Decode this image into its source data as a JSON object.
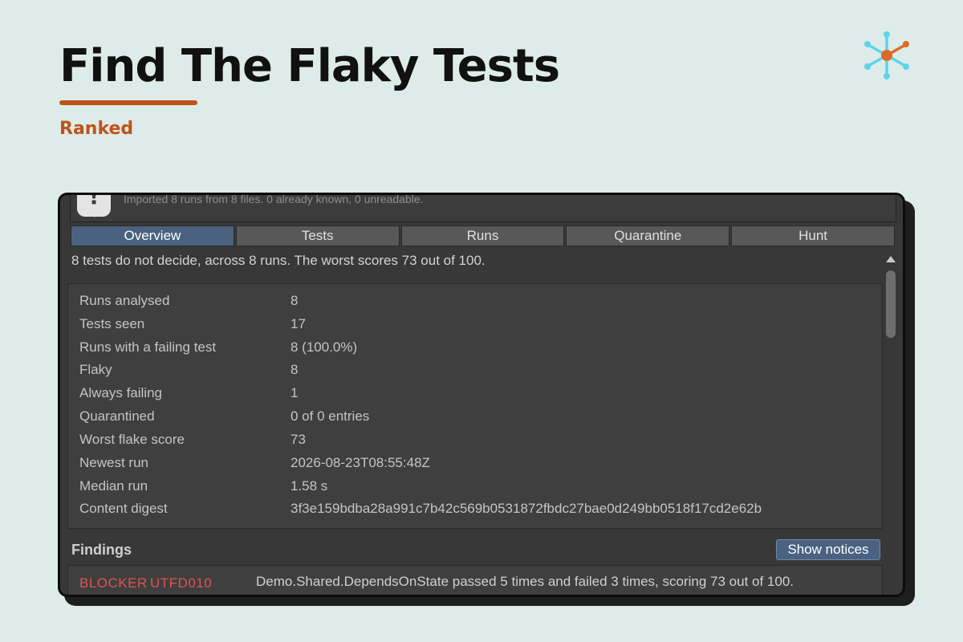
{
  "header": {
    "title": "Find The Flaky Tests",
    "subtitle": "Ranked",
    "accent_color": "#c0531a",
    "logo_colors": [
      "#5ed3ec",
      "#e0682a"
    ]
  },
  "notice": {
    "icon": "exclamation-speech-bubble-icon",
    "text": "Imported 8 runs from 8 files. 0 already known, 0 unreadable."
  },
  "tabs": [
    {
      "label": "Overview",
      "active": true
    },
    {
      "label": "Tests",
      "active": false
    },
    {
      "label": "Runs",
      "active": false
    },
    {
      "label": "Quarantine",
      "active": false
    },
    {
      "label": "Hunt",
      "active": false
    }
  ],
  "overview": {
    "summary": "8 tests do not decide, across 8 runs. The worst scores 73 out of 100.",
    "stats": [
      {
        "label": "Runs analysed",
        "value": "8"
      },
      {
        "label": "Tests seen",
        "value": "17"
      },
      {
        "label": "Runs with a failing test",
        "value": "8 (100.0%)"
      },
      {
        "label": "Flaky",
        "value": "8"
      },
      {
        "label": "Always failing",
        "value": "1"
      },
      {
        "label": "Quarantined",
        "value": "0 of 0 entries"
      },
      {
        "label": "Worst flake score",
        "value": "73"
      },
      {
        "label": "Newest run",
        "value": "2026-08-23T08:55:48Z"
      },
      {
        "label": "Median run",
        "value": "1.58 s"
      },
      {
        "label": "Content digest",
        "value": "3f3e159bdba28a991c7b42c569b0531872fbdc27bae0d249bb0518f17cd2e62b"
      }
    ]
  },
  "findings": {
    "title": "Findings",
    "show_notices_label": "Show notices",
    "items": [
      {
        "severity": "BLOCKER",
        "code": "UTFD010",
        "message": "Demo.Shared.DependsOnState passed 5 times and failed 3 times, scoring 73 out of 100.",
        "severity_color": "#e05252"
      }
    ]
  }
}
